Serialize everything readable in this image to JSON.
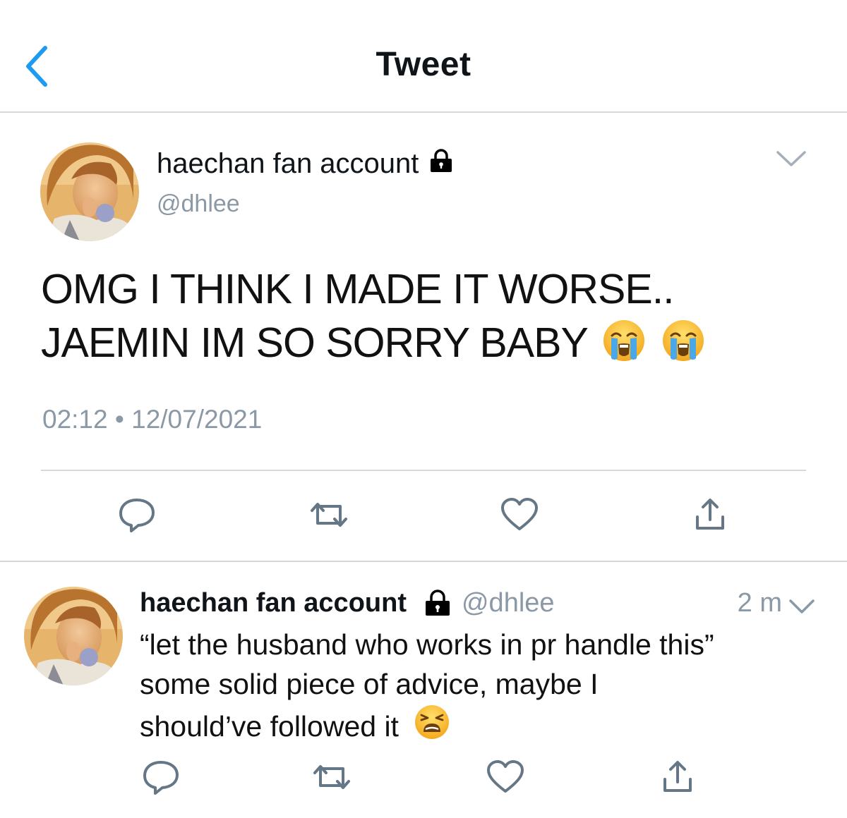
{
  "header": {
    "title": "Tweet",
    "back_icon": "chevron-left-icon",
    "accent": "#1d9bf0"
  },
  "main_tweet": {
    "display_name": "haechan fan account",
    "handle": "@dhlee",
    "protected_icon": "lock-icon",
    "text_lines": [
      "OMG I THINK I MADE IT WORSE..",
      "JAEMIN IM SO SORRY BABY"
    ],
    "emojis": [
      "loudly-crying-face",
      "loudly-crying-face"
    ],
    "time": "02:12",
    "separator": "•",
    "date": "12/07/2021",
    "actions": [
      "reply-icon",
      "retweet-icon",
      "like-icon",
      "share-icon"
    ]
  },
  "reply_tweet": {
    "display_name": "haechan fan account",
    "handle": "@dhlee",
    "protected_icon": "lock-icon",
    "time_ago": "2 m",
    "text_lines": [
      "“let the husband who works in pr handle this”",
      "some solid piece of advice, maybe I",
      "should’ve followed it"
    ],
    "emojis": [
      "weary-face"
    ],
    "actions": [
      "reply-icon",
      "retweet-icon",
      "like-icon",
      "share-icon"
    ]
  },
  "colors": {
    "text": "#0f1419",
    "secondary": "#8b98a5",
    "divider": "#d6d9dc",
    "icon": "#657786"
  }
}
